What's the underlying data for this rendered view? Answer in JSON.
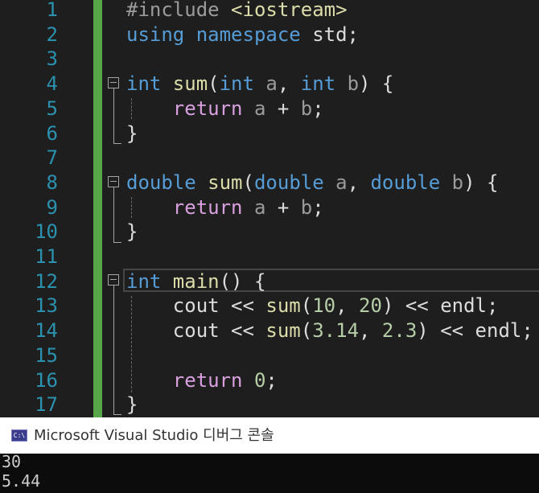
{
  "editor": {
    "line_numbers": [
      "1",
      "2",
      "3",
      "4",
      "5",
      "6",
      "7",
      "8",
      "9",
      "10",
      "11",
      "12",
      "13",
      "14",
      "15",
      "16",
      "17"
    ],
    "lines": [
      [
        {
          "t": "#include ",
          "c": "pp"
        },
        {
          "t": "<iostream>",
          "c": "fn"
        }
      ],
      [
        {
          "t": "using ",
          "c": "kw"
        },
        {
          "t": "namespace ",
          "c": "kw"
        },
        {
          "t": "std;",
          "c": "plain"
        }
      ],
      [],
      [
        {
          "t": "int ",
          "c": "kw"
        },
        {
          "t": "sum",
          "c": "fn"
        },
        {
          "t": "(",
          "c": "plain"
        },
        {
          "t": "int ",
          "c": "kw"
        },
        {
          "t": "a",
          "c": "param"
        },
        {
          "t": ", ",
          "c": "plain"
        },
        {
          "t": "int ",
          "c": "kw"
        },
        {
          "t": "b",
          "c": "param"
        },
        {
          "t": ") {",
          "c": "plain"
        }
      ],
      [
        {
          "t": "    ",
          "c": "plain"
        },
        {
          "t": "return ",
          "c": "ctl"
        },
        {
          "t": "a",
          "c": "param"
        },
        {
          "t": " + ",
          "c": "plain"
        },
        {
          "t": "b",
          "c": "param"
        },
        {
          "t": ";",
          "c": "plain"
        }
      ],
      [
        {
          "t": "}",
          "c": "plain"
        }
      ],
      [],
      [
        {
          "t": "double ",
          "c": "kw"
        },
        {
          "t": "sum",
          "c": "fn"
        },
        {
          "t": "(",
          "c": "plain"
        },
        {
          "t": "double ",
          "c": "kw"
        },
        {
          "t": "a",
          "c": "param"
        },
        {
          "t": ", ",
          "c": "plain"
        },
        {
          "t": "double ",
          "c": "kw"
        },
        {
          "t": "b",
          "c": "param"
        },
        {
          "t": ") {",
          "c": "plain"
        }
      ],
      [
        {
          "t": "    ",
          "c": "plain"
        },
        {
          "t": "return ",
          "c": "ctl"
        },
        {
          "t": "a",
          "c": "param"
        },
        {
          "t": " + ",
          "c": "plain"
        },
        {
          "t": "b",
          "c": "param"
        },
        {
          "t": ";",
          "c": "plain"
        }
      ],
      [
        {
          "t": "}",
          "c": "plain"
        }
      ],
      [],
      [
        {
          "t": "int ",
          "c": "kw"
        },
        {
          "t": "main",
          "c": "fn"
        },
        {
          "t": "() {",
          "c": "plain"
        }
      ],
      [
        {
          "t": "    ",
          "c": "plain"
        },
        {
          "t": "cout ",
          "c": "plain"
        },
        {
          "t": "<< ",
          "c": "plain"
        },
        {
          "t": "sum",
          "c": "fn"
        },
        {
          "t": "(",
          "c": "plain"
        },
        {
          "t": "10",
          "c": "num"
        },
        {
          "t": ", ",
          "c": "plain"
        },
        {
          "t": "20",
          "c": "num"
        },
        {
          "t": ") ",
          "c": "plain"
        },
        {
          "t": "<< ",
          "c": "plain"
        },
        {
          "t": "endl;",
          "c": "plain"
        }
      ],
      [
        {
          "t": "    ",
          "c": "plain"
        },
        {
          "t": "cout ",
          "c": "plain"
        },
        {
          "t": "<< ",
          "c": "plain"
        },
        {
          "t": "sum",
          "c": "fn"
        },
        {
          "t": "(",
          "c": "plain"
        },
        {
          "t": "3.14",
          "c": "num"
        },
        {
          "t": ", ",
          "c": "plain"
        },
        {
          "t": "2.3",
          "c": "num"
        },
        {
          "t": ") ",
          "c": "plain"
        },
        {
          "t": "<< ",
          "c": "plain"
        },
        {
          "t": "endl;",
          "c": "plain"
        }
      ],
      [],
      [
        {
          "t": "    ",
          "c": "plain"
        },
        {
          "t": "return ",
          "c": "ctl"
        },
        {
          "t": "0",
          "c": "num"
        },
        {
          "t": ";",
          "c": "plain"
        }
      ],
      [
        {
          "t": "}",
          "c": "plain"
        }
      ]
    ]
  },
  "console": {
    "title": "Microsoft Visual Studio 디버그 콘솔",
    "icon_label": "C:\\",
    "output": [
      "30",
      "5.44"
    ]
  },
  "colors": {
    "background": "#1e1e1e",
    "line_number": "#2b91af",
    "keyword": "#569cd6",
    "function": "#dcdcaa",
    "control": "#d8a0df",
    "number": "#b5cea8",
    "change_bar": "#57a64a"
  }
}
